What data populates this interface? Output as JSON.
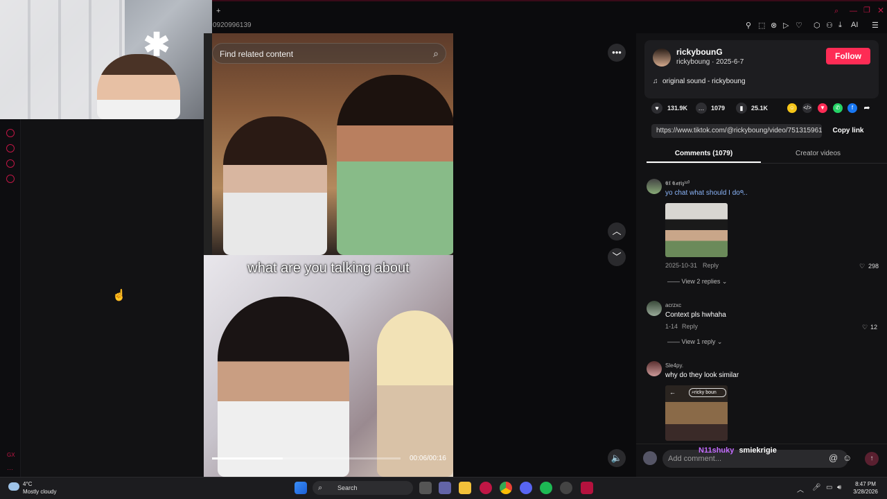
{
  "browser": {
    "phone_id": "0920996139",
    "new_tab": "+"
  },
  "video": {
    "search_placeholder": "Find related content",
    "caption": "what are you talking about",
    "time": "00:06/00:16",
    "progress": 0.375
  },
  "author": {
    "name": "rickybounG",
    "handle_date": "rickyboung · 2025-6-7",
    "follow_label": "Follow",
    "music": "original sound - rickyboung"
  },
  "stats": {
    "likes": "131.9K",
    "comments": "1079",
    "bookmarks": "25.1K"
  },
  "link": {
    "url": "https://www.tiktok.com/@rickyboung/video/751315961...",
    "copy_label": "Copy link"
  },
  "tabs": {
    "comments": "Comments (1079)",
    "creator": "Creator videos"
  },
  "comments": [
    {
      "user": "𝕰𝖑 𝕮𝖆𝖋𝖎𝖟³¹⁰",
      "text": "yo chat what should I do੧..",
      "date": "2025-10-31",
      "reply": "Reply",
      "likes": "298",
      "view_replies": "View 2 replies"
    },
    {
      "user": "acrzxc",
      "text": "Context pls hwhaha",
      "date": "1-14",
      "reply": "Reply",
      "likes": "12",
      "view_replies": "View 1 reply"
    },
    {
      "user": "Sle4py.",
      "text": "why do they look similar",
      "img_label": "ricky boun"
    }
  ],
  "comment_bar": {
    "placeholder": "Add comment...",
    "overlay_user1": "N11shuky",
    "overlay_user2": "smiekrigie"
  },
  "taskbar": {
    "temp": "4°C",
    "weather": "Mostly cloudy",
    "search": "Search",
    "time": "8:47 PM",
    "date": "3/28/2026"
  },
  "colors": {
    "accent": "#fe2c55",
    "opera_red": "#c01645"
  }
}
